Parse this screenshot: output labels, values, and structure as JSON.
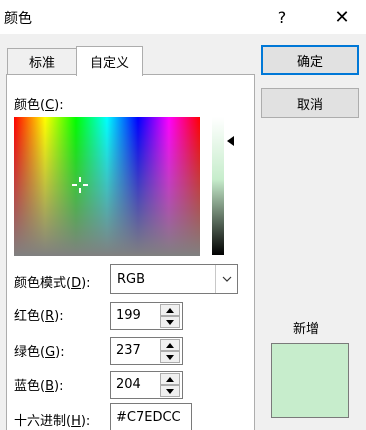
{
  "window": {
    "title": "颜色",
    "help_label": "?",
    "close_label": "✕"
  },
  "tabs": [
    {
      "label": "标准"
    },
    {
      "label": "自定义"
    }
  ],
  "color_label": {
    "text": "颜色(",
    "key": "C",
    "end": "):"
  },
  "mode": {
    "text": "颜色模式(",
    "key": "D",
    "end": "):",
    "value": "RGB"
  },
  "red": {
    "text": "红色(",
    "key": "R",
    "end": "):",
    "value": "199"
  },
  "green": {
    "text": "绿色(",
    "key": "G",
    "end": "):",
    "value": "237"
  },
  "blue": {
    "text": "蓝色(",
    "key": "B",
    "end": "):",
    "value": "204"
  },
  "hex": {
    "text": "十六进制(",
    "key": "H",
    "end": "):",
    "value": "#C7EDCC"
  },
  "buttons": {
    "ok": "确定",
    "cancel": "取消"
  },
  "preview": {
    "label": "新增",
    "color": "#C7EDCC"
  },
  "icons": {
    "crosshair": "crosshair-icon",
    "dropdown": "chevron-down-icon",
    "arrow": "luminance-arrow-icon"
  }
}
